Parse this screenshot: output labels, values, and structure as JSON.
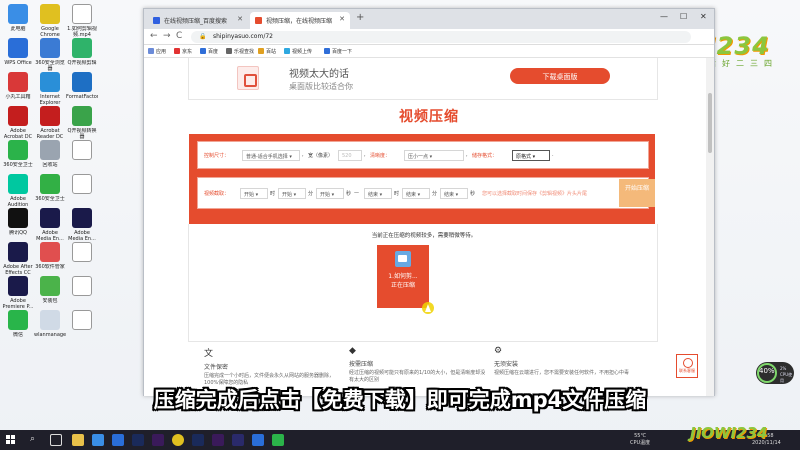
{
  "desktop": {
    "icons": [
      {
        "label": "此电脑",
        "color": "#3a8ee6"
      },
      {
        "label": "Google Chrome",
        "color": "#e0c020"
      },
      {
        "label": "1.如何剪辑视频.mp4",
        "color": "#ffffff"
      },
      {
        "label": "WPS Office",
        "color": "#2a6ed8"
      },
      {
        "label": "360安全浏览器",
        "color": "#3b7bd4"
      },
      {
        "label": "Q开视频剪辑",
        "color": "#2fb36a"
      },
      {
        "label": "小丸工具箱",
        "color": "#d93838"
      },
      {
        "label": "Internet Explorer",
        "color": "#2a8fd8"
      },
      {
        "label": "FormatFactory",
        "color": "#1e6fc4"
      },
      {
        "label": "Adobe Acrobat DC",
        "color": "#c41e1e"
      },
      {
        "label": "Acrobat Reader DC",
        "color": "#c41e1e"
      },
      {
        "label": "Q开视频转换器",
        "color": "#3aa34a"
      },
      {
        "label": "360安全卫士",
        "color": "#2bb34a"
      },
      {
        "label": "回收站",
        "color": "#9aa4b0"
      },
      {
        "label": "",
        "color": "#ffffff"
      },
      {
        "label": "Adobe Audition",
        "color": "#00c8a0"
      },
      {
        "label": "360安全卫士",
        "color": "#32b045"
      },
      {
        "label": "",
        "color": "#ffffff"
      },
      {
        "label": "腾讯QQ",
        "color": "#111111"
      },
      {
        "label": "Adobe Media En...",
        "color": "#1a1a4a"
      },
      {
        "label": "Adobe Media En...",
        "color": "#1a1a4a"
      },
      {
        "label": "Adobe After Effects CC",
        "color": "#1a1a4a"
      },
      {
        "label": "360软件管家",
        "color": "#e04f4f"
      },
      {
        "label": "",
        "color": "#ffffff"
      },
      {
        "label": "Adobe Premiere P...",
        "color": "#1a1a4a"
      },
      {
        "label": "安装包",
        "color": "#4bb34a"
      },
      {
        "label": "",
        "color": "#ffffff"
      },
      {
        "label": "微信",
        "color": "#29b54a"
      },
      {
        "label": "wlanmanager",
        "color": "#d0dae6"
      },
      {
        "label": "",
        "color": "#ffffff"
      }
    ]
  },
  "browser": {
    "tabs": [
      {
        "label": "在线视频压缩_百度搜索",
        "fav_color": "#3060e0"
      },
      {
        "label": "视频压缩，在线视频压缩",
        "fav_color": "#e54c2e"
      }
    ],
    "new_tab": "+",
    "win_min": "—",
    "win_max": "☐",
    "win_close": "✕",
    "back": "←",
    "forward": "→",
    "reload": "C",
    "url": "shipinyasuo.com/72",
    "bookmarks": [
      {
        "label": "应用",
        "color": "#6b8bd8"
      },
      {
        "label": "京东",
        "color": "#e23232"
      },
      {
        "label": "百度",
        "color": "#2f6ed8"
      },
      {
        "label": "乐视查找",
        "color": "#666666"
      },
      {
        "label": "百站",
        "color": "#e0a020"
      },
      {
        "label": "视频上传",
        "color": "#2ea8e0"
      },
      {
        "label": "百度一下",
        "color": "#2f6ed8"
      }
    ]
  },
  "page": {
    "banner": {
      "title": "视频太大的话",
      "subtitle": "桌面版比较适合你",
      "download_button": "下载桌面版"
    },
    "title": "视频压缩",
    "settings": {
      "size_label": "控制尺寸：",
      "size_value": "普通-适合手机选择",
      "width_label": "宽（像素）",
      "width_value": "520",
      "clarity_label": "清晰度：",
      "clarity_value": "压小一点",
      "format_label": "储存格式：",
      "format_value": "原格式"
    },
    "clip": {
      "label": "视频截取：",
      "start": "开始",
      "end": "结束",
      "hour": "时",
      "minute": "分",
      "second": "秒",
      "note": "您可以选择截取时间保存《剪辑视频》片头片尾",
      "start_button": "开始压缩"
    },
    "status_text": "当前正在压缩的视频较多，需要稍微等待。",
    "file": {
      "name": "1.如何剪...",
      "state": "正在压缩"
    },
    "features": [
      {
        "icon": "文",
        "title": "文件保密",
        "desc": "压缩完成一个小时后，文件便会永久从网站的服务器删除，100%保障您的隐私"
      },
      {
        "icon": "◆",
        "title": "按需压缩",
        "desc": "经过压缩的视频可能只有原来的1/10的大小，但是清晰度却没有太大的区别"
      },
      {
        "icon": "⚙",
        "title": "无须安装",
        "desc": "视频压缩在云端进行，您不需要安装任何软件，不用担心中毒"
      }
    ],
    "help_label": "联系客服"
  },
  "overlay": {
    "subtitle": "压缩完成后点击【免费下载】即可完成mp4文件压缩",
    "brand": "JIOWI234",
    "brand_sub": "好生活好二三四",
    "brand_small": "JIOWI234"
  },
  "cpu_widget": {
    "percent": "40%",
    "line1": "2%",
    "line2": "CPU使用"
  },
  "taskbar": {
    "temp": "55℃",
    "temp_label": "CPU温度",
    "time": "14:58",
    "date": "2020/11/14"
  }
}
